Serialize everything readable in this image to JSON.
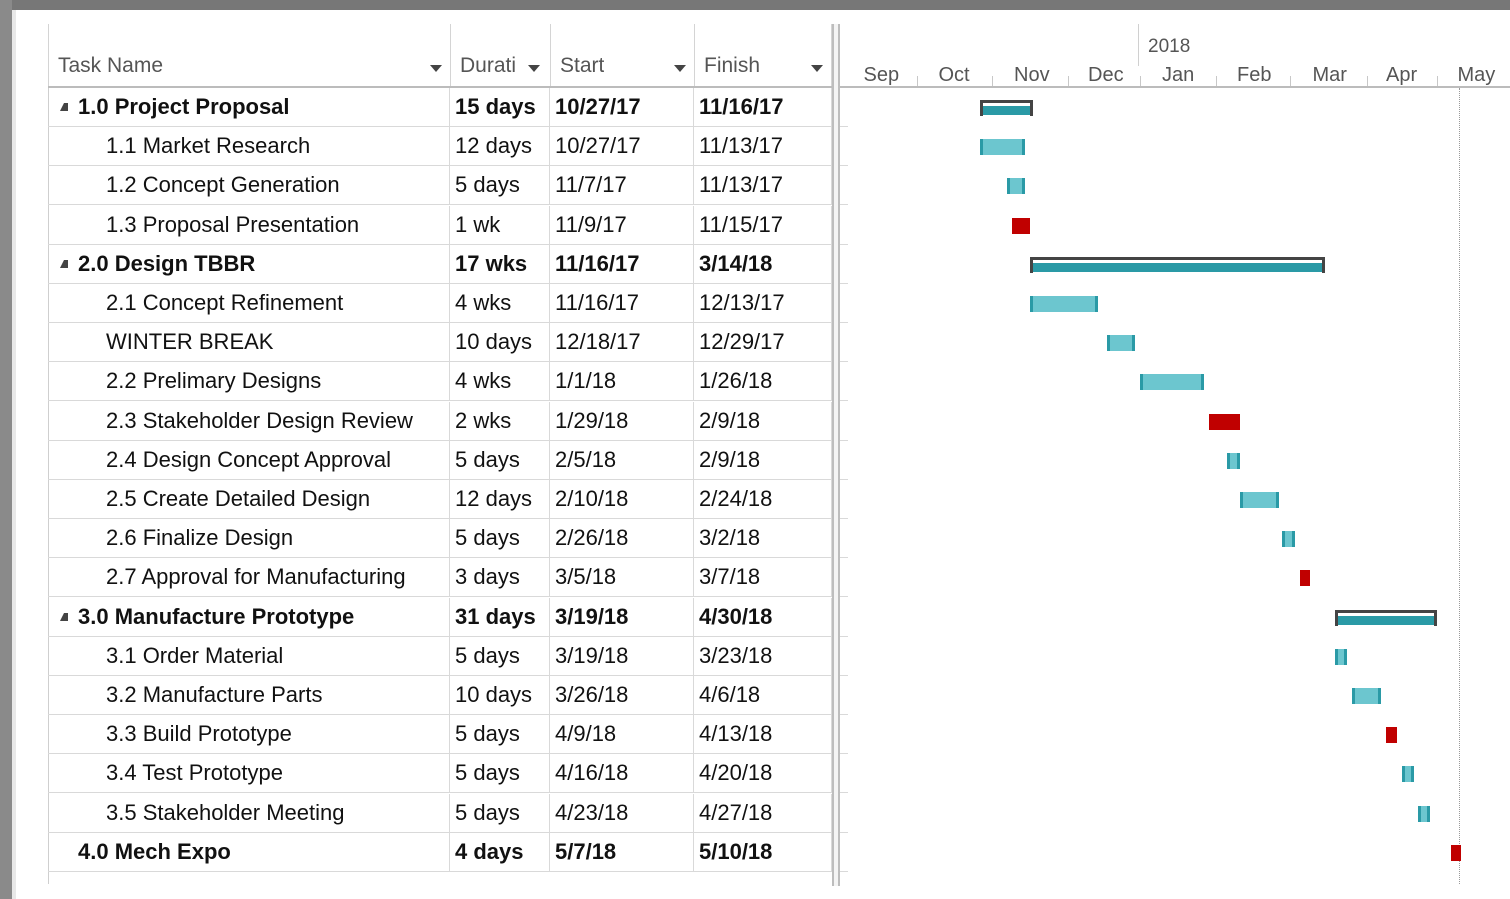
{
  "columns": {
    "task_name": "Task Name",
    "duration": "Durati",
    "start": "Start",
    "finish": "Finish"
  },
  "timescale": {
    "year_label": "2018",
    "months": [
      "Sep",
      "Oct",
      "Nov",
      "Dec",
      "Jan",
      "Feb",
      "Mar",
      "Apr",
      "May"
    ]
  },
  "tasks": [
    {
      "name": "1.0 Project Proposal",
      "duration": "15 days",
      "start": "10/27/17",
      "finish": "11/16/17",
      "summary": true,
      "critical": false
    },
    {
      "name": "1.1 Market Research",
      "duration": "12 days",
      "start": "10/27/17",
      "finish": "11/13/17",
      "summary": false,
      "critical": false
    },
    {
      "name": "1.2 Concept Generation",
      "duration": "5 days",
      "start": "11/7/17",
      "finish": "11/13/17",
      "summary": false,
      "critical": false
    },
    {
      "name": "1.3 Proposal Presentation",
      "duration": "1 wk",
      "start": "11/9/17",
      "finish": "11/15/17",
      "summary": false,
      "critical": true
    },
    {
      "name": "2.0 Design TBBR",
      "duration": "17 wks",
      "start": "11/16/17",
      "finish": "3/14/18",
      "summary": true,
      "critical": false
    },
    {
      "name": "2.1 Concept Refinement",
      "duration": "4 wks",
      "start": "11/16/17",
      "finish": "12/13/17",
      "summary": false,
      "critical": false
    },
    {
      "name": "WINTER BREAK",
      "duration": "10 days",
      "start": "12/18/17",
      "finish": "12/29/17",
      "summary": false,
      "critical": false
    },
    {
      "name": "2.2 Prelimary Designs",
      "duration": "4 wks",
      "start": "1/1/18",
      "finish": "1/26/18",
      "summary": false,
      "critical": false
    },
    {
      "name": "2.3 Stakeholder Design Review",
      "duration": "2 wks",
      "start": "1/29/18",
      "finish": "2/9/18",
      "summary": false,
      "critical": true
    },
    {
      "name": "2.4 Design Concept Approval",
      "duration": "5 days",
      "start": "2/5/18",
      "finish": "2/9/18",
      "summary": false,
      "critical": false
    },
    {
      "name": "2.5 Create Detailed Design",
      "duration": "12 days",
      "start": "2/10/18",
      "finish": "2/24/18",
      "summary": false,
      "critical": false
    },
    {
      "name": "2.6 Finalize Design",
      "duration": "5 days",
      "start": "2/26/18",
      "finish": "3/2/18",
      "summary": false,
      "critical": false
    },
    {
      "name": "2.7 Approval for Manufacturing",
      "duration": "3 days",
      "start": "3/5/18",
      "finish": "3/7/18",
      "summary": false,
      "critical": true
    },
    {
      "name": "3.0 Manufacture Prototype",
      "duration": "31 days",
      "start": "3/19/18",
      "finish": "4/30/18",
      "summary": true,
      "critical": false
    },
    {
      "name": "3.1 Order Material",
      "duration": "5 days",
      "start": "3/19/18",
      "finish": "3/23/18",
      "summary": false,
      "critical": false
    },
    {
      "name": "3.2 Manufacture Parts",
      "duration": "10 days",
      "start": "3/26/18",
      "finish": "4/6/18",
      "summary": false,
      "critical": false
    },
    {
      "name": "3.3 Build Prototype",
      "duration": "5 days",
      "start": "4/9/18",
      "finish": "4/13/18",
      "summary": false,
      "critical": true
    },
    {
      "name": "3.4 Test Prototype",
      "duration": "5 days",
      "start": "4/16/18",
      "finish": "4/20/18",
      "summary": false,
      "critical": false
    },
    {
      "name": "3.5 Stakeholder Meeting",
      "duration": "5 days",
      "start": "4/23/18",
      "finish": "4/27/18",
      "summary": false,
      "critical": false
    },
    {
      "name": "4.0 Mech Expo",
      "duration": "4 days",
      "start": "5/7/18",
      "finish": "5/10/18",
      "summary": true,
      "critical": true
    }
  ],
  "colors": {
    "bar": "#6cc6cf",
    "bar_edge": "#2a9aa6",
    "critical": "#c00000",
    "summary_bracket": "#444444"
  }
}
